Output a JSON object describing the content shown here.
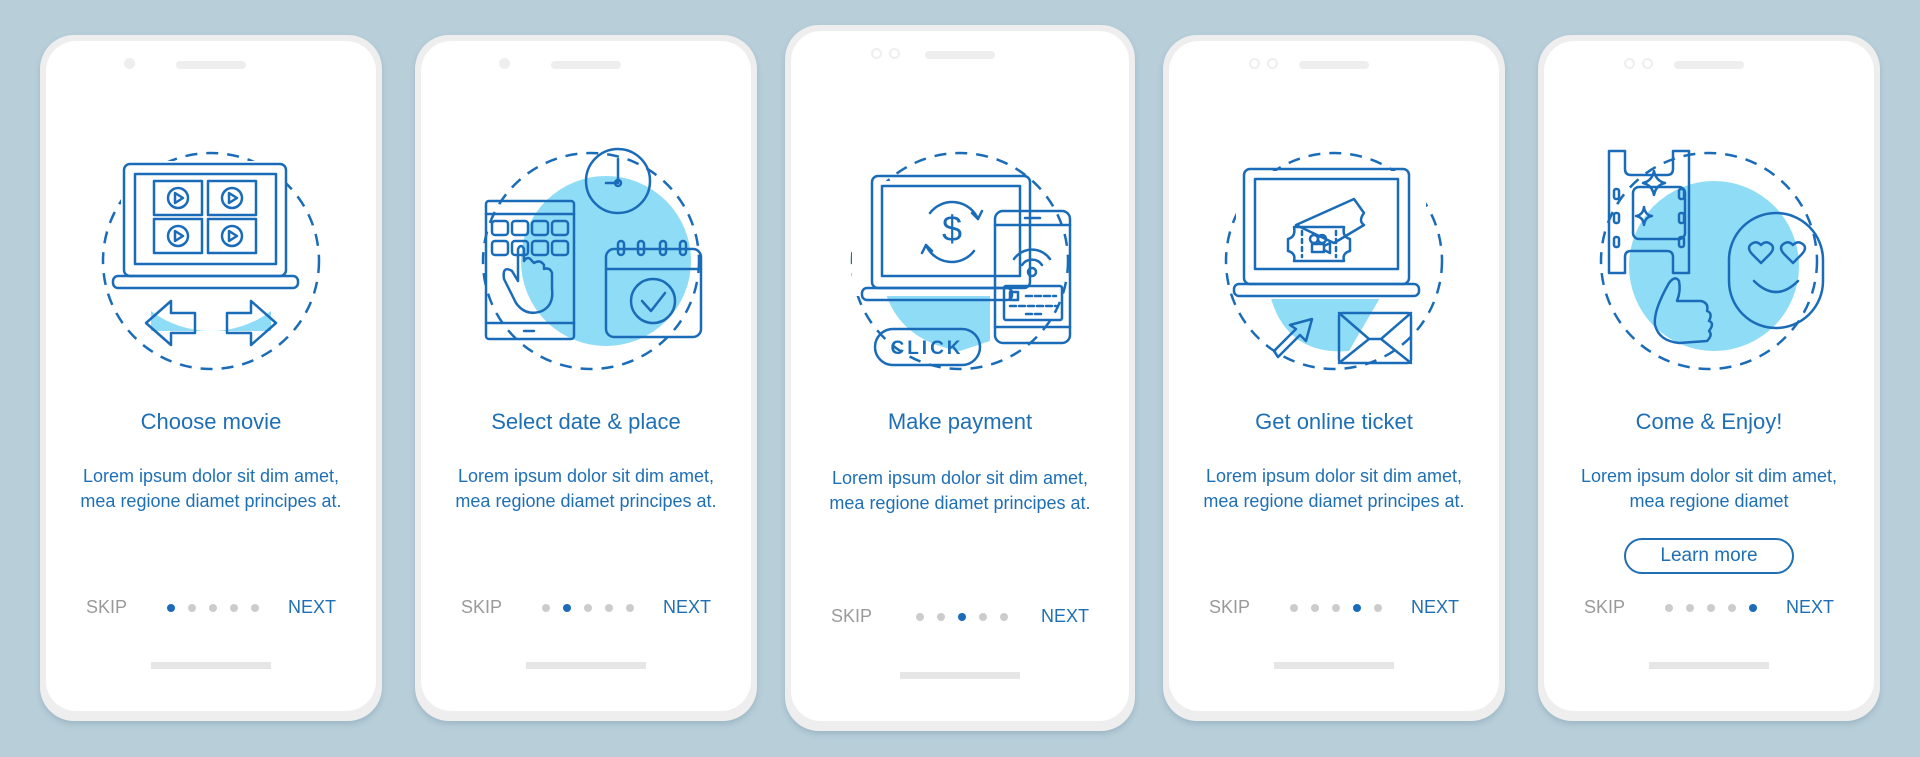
{
  "colors": {
    "background": "#b8cfda",
    "accent": "#1f6fb5",
    "muted_text": "#9a9a9a",
    "dot_inactive": "#cccccc",
    "dot_active": "#1a6cb8",
    "illustration_fill": "#8fdcf7"
  },
  "screens": [
    {
      "title": "Choose movie",
      "description": "Lorem ipsum dolor sit dim amet, mea regione diamet principes at.",
      "skip_label": "SKIP",
      "next_label": "NEXT",
      "active_step": 1,
      "total_steps": 5,
      "illustration": "laptop-video-grid-arrows-icon"
    },
    {
      "title": "Select date & place",
      "description": "Lorem ipsum dolor sit dim amet, mea regione diamet principes at.",
      "skip_label": "SKIP",
      "next_label": "NEXT",
      "active_step": 2,
      "total_steps": 5,
      "illustration": "tablet-clock-calendar-icon"
    },
    {
      "title": "Make payment",
      "description": "Lorem ipsum dolor sit dim amet, mea regione diamet principes at.",
      "skip_label": "SKIP",
      "next_label": "NEXT",
      "active_step": 3,
      "total_steps": 5,
      "illustration": "laptop-payment-phone-icon",
      "illustration_text": "CLICK"
    },
    {
      "title": "Get online ticket",
      "description": "Lorem ipsum dolor sit dim amet, mea regione diamet principes at.",
      "skip_label": "SKIP",
      "next_label": "NEXT",
      "active_step": 4,
      "total_steps": 5,
      "illustration": "laptop-ticket-envelope-icon"
    },
    {
      "title": "Come & Enjoy!",
      "description": "Lorem ipsum dolor sit dim amet, mea regione diamet",
      "skip_label": "SKIP",
      "next_label": "NEXT",
      "button_label": "Learn more",
      "active_step": 5,
      "total_steps": 5,
      "illustration": "film-thumbsup-smiley-icon"
    }
  ]
}
